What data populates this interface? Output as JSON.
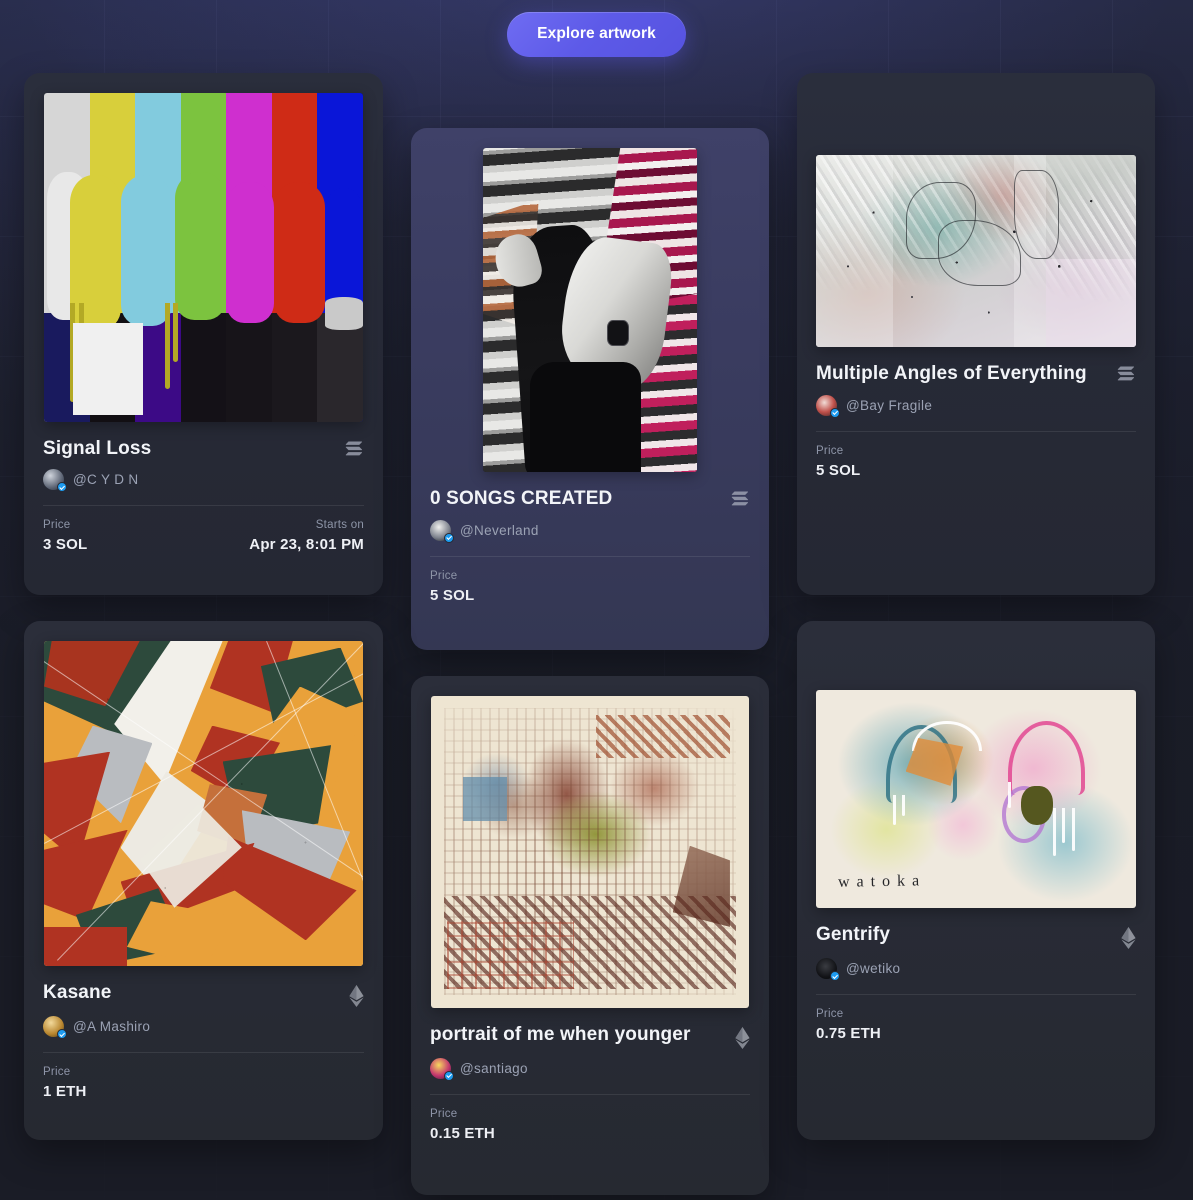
{
  "header": {
    "explore_button_label": "Explore artwork"
  },
  "colors": {
    "accent": "#5d5ae8",
    "page_background": "#1b1e2b",
    "card_background": "#2a2e3c",
    "card_background_tinted": "#3f4168",
    "title_text": "#f2f4f8",
    "muted_text": "#9ba2b4",
    "verified_badge": "#1d9bf0"
  },
  "labels": {
    "price": "Price",
    "starts_on": "Starts on"
  },
  "cards": [
    {
      "id": "signal-loss",
      "title": "Signal Loss",
      "handle": "@C Y D N",
      "verified": true,
      "chain_icon": "solana-icon",
      "price_label": "Price",
      "price_value": "3 SOL",
      "secondary_label": "Starts on",
      "secondary_value": "Apr 23, 8:01 PM",
      "artwork_alt": "TV color bar test pattern with dripping paint"
    },
    {
      "id": "songs-created",
      "title": "0 SONGS CREATED",
      "handle": "@Neverland",
      "verified": true,
      "chain_icon": "solana-icon",
      "price_label": "Price",
      "price_value": "5 SOL",
      "secondary_label": "",
      "secondary_value": "",
      "artwork_alt": "Black and white photo of a person against a striped corrugated wall"
    },
    {
      "id": "multiple-angles-of-everything",
      "title": "Multiple Angles of Everything",
      "handle": "@Bay Fragile",
      "verified": true,
      "chain_icon": "solana-icon",
      "price_label": "Price",
      "price_value": "5 SOL",
      "secondary_label": "",
      "secondary_value": "",
      "artwork_alt": "Pale abstract expressionist painting with teal and pink scratches"
    },
    {
      "id": "kasane",
      "title": "Kasane",
      "handle": "@A Mashiro",
      "verified": true,
      "chain_icon": "ethereum-icon",
      "price_label": "Price",
      "price_value": "1 ETH",
      "secondary_label": "",
      "secondary_value": "",
      "artwork_alt": "Abstract geometric collage in orange, red, green and white"
    },
    {
      "id": "portrait-of-me-when-younger",
      "title": "portrait of me when younger",
      "handle": "@santiago",
      "verified": true,
      "chain_icon": "ethereum-icon",
      "price_label": "Price",
      "price_value": "0.15 ETH",
      "secondary_label": "",
      "secondary_value": "",
      "artwork_alt": "Glitch collage in cream, olive and rust tones"
    },
    {
      "id": "gentrify",
      "title": "Gentrify",
      "handle": "@wetiko",
      "verified": true,
      "chain_icon": "ethereum-icon",
      "price_label": "Price",
      "price_value": "0.75 ETH",
      "secondary_label": "",
      "secondary_value": "",
      "artwork_alt": "Pastel abstract painting with handwritten word"
    }
  ]
}
